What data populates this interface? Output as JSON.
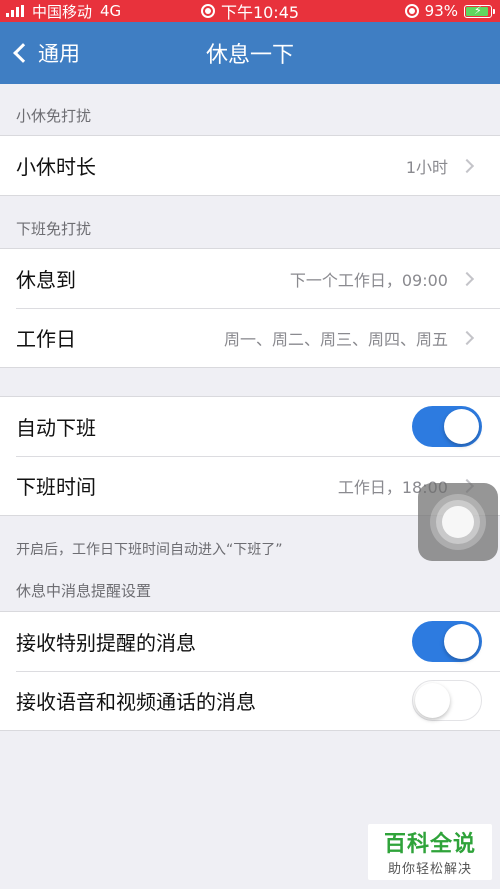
{
  "status_bar": {
    "carrier": "中国移动",
    "network": "4G",
    "time": "下午10:45",
    "battery_percent": "93%",
    "battery_level": 0.93,
    "bg_color": "#e8323c"
  },
  "nav": {
    "back_label": "通用",
    "title": "休息一下",
    "bg_color": "#3f7ec3"
  },
  "sections": {
    "break": {
      "header": "小休免打扰",
      "duration_label": "小休时长",
      "duration_value": "1小时"
    },
    "offwork": {
      "header": "下班免打扰",
      "rest_until_label": "休息到",
      "rest_until_value": "下一个工作日，09:00",
      "workdays_label": "工作日",
      "workdays_value": "周一、周二、周三、周四、周五"
    },
    "auto": {
      "auto_offwork_label": "自动下班",
      "auto_offwork_on": true,
      "offwork_time_label": "下班时间",
      "offwork_time_value": "工作日，18:00",
      "footnote": "开启后，工作日下班时间自动进入“下班了”"
    },
    "reminders": {
      "header": "休息中消息提醒设置",
      "special_label": "接收特别提醒的消息",
      "special_on": true,
      "calls_label": "接收语音和视频通话的消息",
      "calls_on": false
    }
  },
  "toggle_on_color": "#2d7be0",
  "watermark": {
    "title": "百科全说",
    "subtitle": "助你轻松解决"
  }
}
